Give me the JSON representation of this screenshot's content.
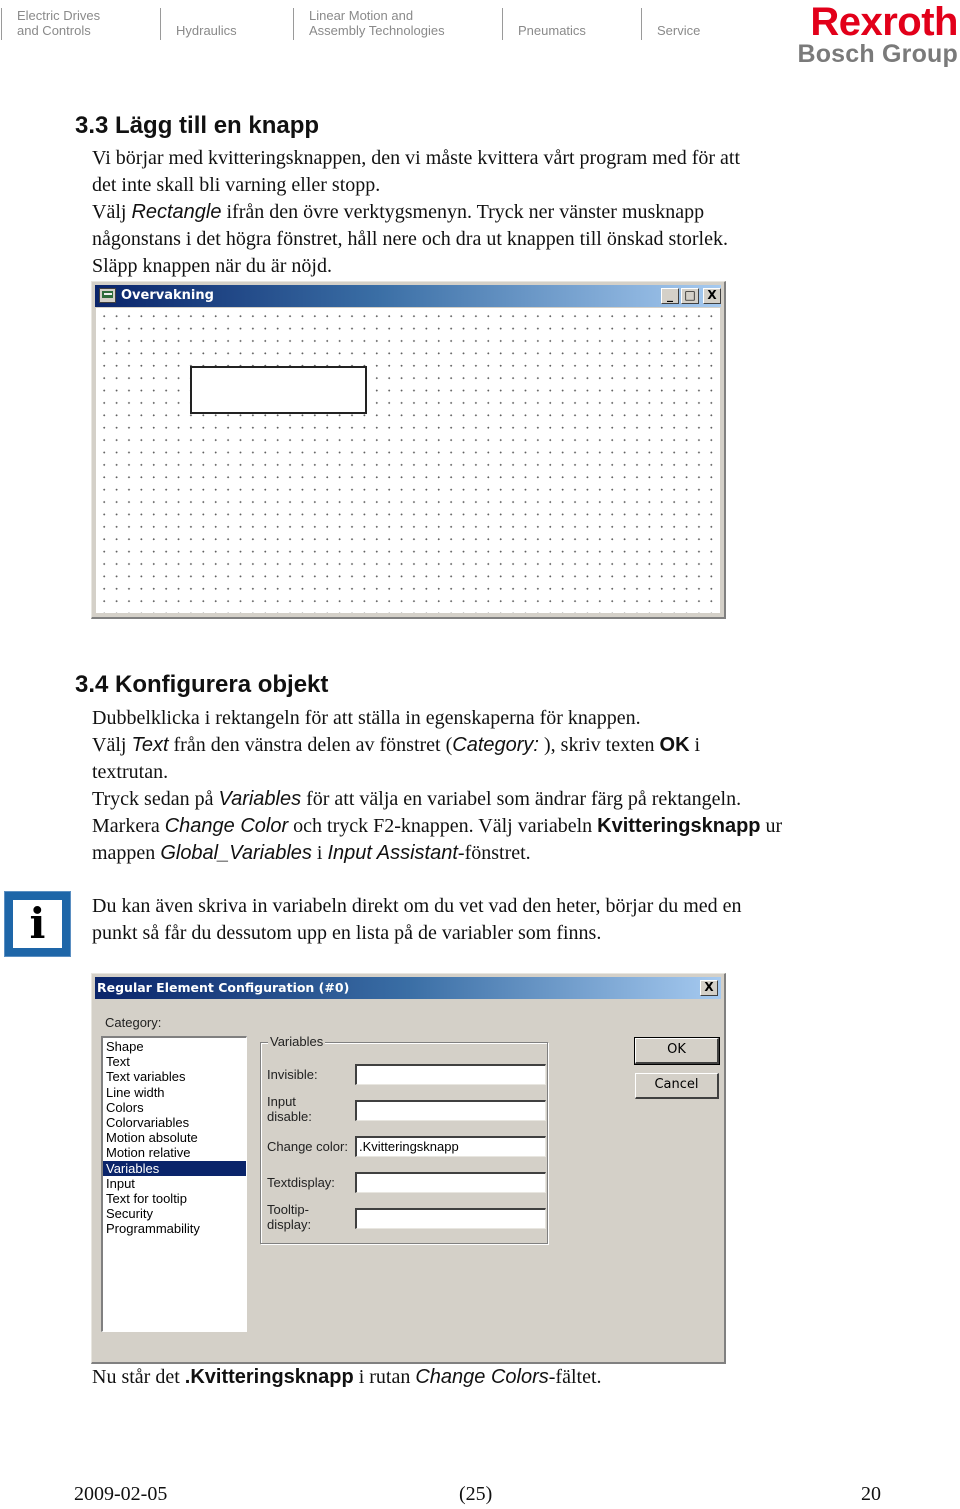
{
  "header": {
    "divisions": [
      {
        "line1": "Electric Drives",
        "line2": "and Controls"
      },
      {
        "line1": "",
        "line2": "Hydraulics"
      },
      {
        "line1": "Linear Motion and",
        "line2": "Assembly Technologies"
      },
      {
        "line1": "",
        "line2": "Pneumatics"
      },
      {
        "line1": "",
        "line2": "Service"
      }
    ],
    "logo": {
      "brand": "Rexroth",
      "group": "Bosch Group",
      "brand_color": "#e2001a"
    }
  },
  "section_33": {
    "heading": "3.3 Lägg till en knapp",
    "p1": "Vi börjar med kvitteringsknappen, den vi måste kvittera vårt program med för att",
    "p2": "det inte skall bli varning eller stopp.",
    "p3_pre": "Välj ",
    "p3_italic": "Rectangle",
    "p3_post": " ifrån den övre verktygsmenyn. Tryck ner vänster musknapp",
    "p4": "någonstans i det högra fönstret, håll nere och dra ut knappen till önskad storlek.",
    "p5": "Släpp knappen när du är nöjd."
  },
  "window1": {
    "title": "Overvakning",
    "minimize": "_",
    "maximize": "□",
    "close": "X"
  },
  "section_34": {
    "heading": "3.4 Konfigurera objekt",
    "l1": "Dubbelklicka i rektangeln för att ställa in egenskaperna för knappen.",
    "l2_a": "Välj ",
    "l2_b": "Text",
    "l2_c": " från den vänstra delen av fönstret (",
    "l2_d": "Category:",
    "l2_e": " ), skriv texten ",
    "l2_f": "OK",
    "l2_g": " i",
    "l3": "textrutan.",
    "l4_a": "Tryck sedan på ",
    "l4_b": "Variables",
    "l4_c": " för att välja en variabel som ändrar färg på rektangeln.",
    "l5_a": "Markera ",
    "l5_b": "Change Color",
    "l5_c": " och tryck F2-knappen. Välj variabeln ",
    "l5_d": "Kvitteringsknapp",
    "l5_e": " ur",
    "l6_a": "mappen ",
    "l6_b": "Global_Variables",
    "l6_c": " i ",
    "l6_d": "Input Assistant",
    "l6_e": "-fönstret."
  },
  "info": {
    "icon": "info-icon",
    "glyph": "i",
    "l1": "Du kan även skriva in variabeln direkt om du vet vad den heter, börjar du med en",
    "l2": "punkt så får du dessutom upp en lista på de variabler som finns."
  },
  "dialog": {
    "title": "Regular Element Configuration (#0)",
    "close": "X",
    "category_label": "Category:",
    "categories": [
      "Shape",
      "Text",
      "Text variables",
      "Line width",
      "Colors",
      "Colorvariables",
      "Motion absolute",
      "Motion relative",
      "Variables",
      "Input",
      "Text for tooltip",
      "Security",
      "Programmability"
    ],
    "selected_category": "Variables",
    "group_label": "Variables",
    "fields": {
      "invisible": {
        "label": "Invisible:",
        "value": ""
      },
      "input_disable": {
        "label1": "Input",
        "label2": "disable:",
        "value": ""
      },
      "change_color": {
        "label": "Change color:",
        "value": ".Kvitteringsknapp"
      },
      "textdisplay": {
        "label": "Textdisplay:",
        "value": ""
      },
      "tooltip_display": {
        "label1": "Tooltip-",
        "label2": "display:",
        "value": ""
      }
    },
    "ok": "OK",
    "cancel": "Cancel"
  },
  "closing": {
    "a": "Nu står det ",
    "b": ".Kvitteringsknapp",
    "c": " i rutan ",
    "d": "Change Colors",
    "e": "-fältet."
  },
  "footer": {
    "date": "2009-02-05",
    "page_in_parens": "(25)",
    "page_number": "20"
  }
}
